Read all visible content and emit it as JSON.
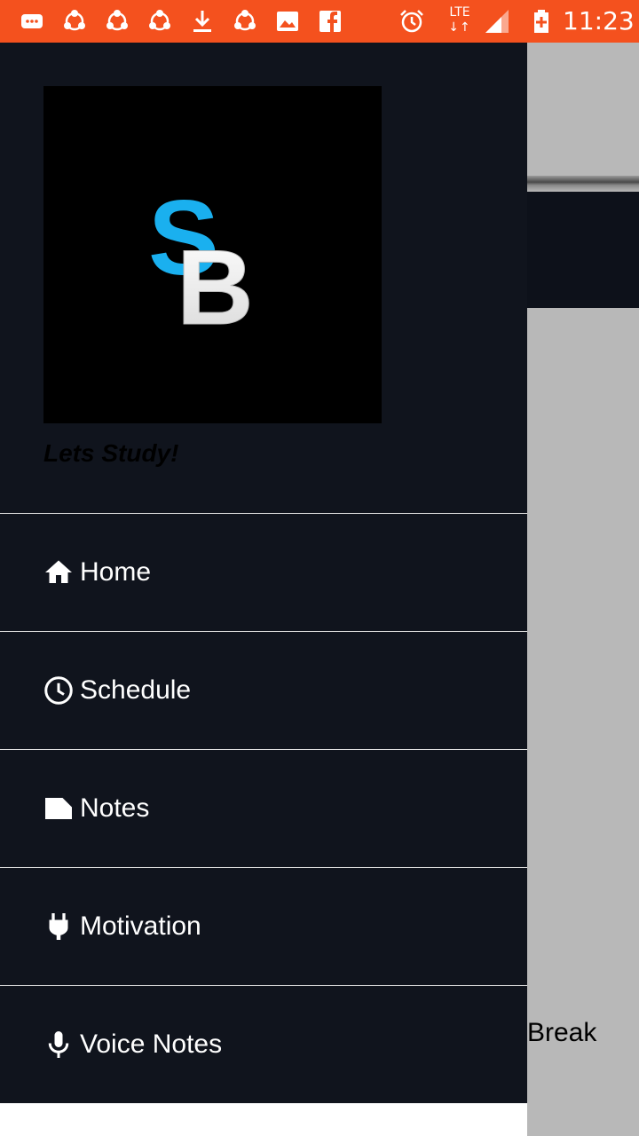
{
  "status_bar": {
    "network_type": "LTE",
    "network_arrows": "↓↑",
    "time": "11:23",
    "icons": [
      "chat-icon",
      "share-icon",
      "share-icon",
      "share-icon",
      "download-icon",
      "share-icon",
      "image-icon",
      "facebook-icon",
      "alarm-icon",
      "signal-icon",
      "battery-icon"
    ],
    "background_color": "#f4511e"
  },
  "drawer": {
    "header": {
      "logo_letters": [
        "S",
        "B"
      ],
      "tagline": "Lets Study!"
    },
    "items": [
      {
        "label": "Home",
        "icon": "home-icon"
      },
      {
        "label": "Schedule",
        "icon": "clock-icon"
      },
      {
        "label": "Notes",
        "icon": "note-icon"
      },
      {
        "label": "Motivation",
        "icon": "plug-icon"
      },
      {
        "label": "Voice Notes",
        "icon": "mic-icon"
      }
    ],
    "background_color": "#10141d"
  },
  "background_app": {
    "visible_text": "Break"
  }
}
